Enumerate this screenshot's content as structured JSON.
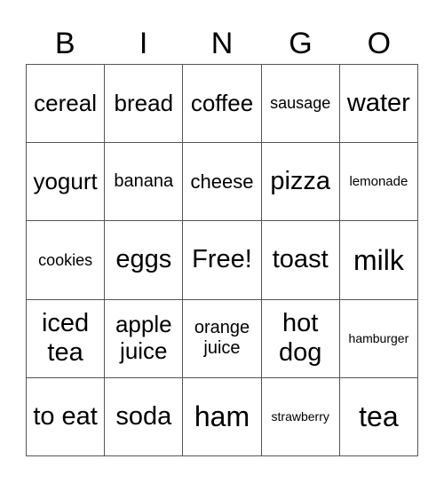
{
  "header": {
    "letters": [
      "B",
      "I",
      "N",
      "G",
      "O"
    ]
  },
  "grid": {
    "rows": [
      [
        "cereal",
        "bread",
        "coffee",
        "sausage",
        "water"
      ],
      [
        "yogurt",
        "banana",
        "cheese",
        "pizza",
        "lemonade"
      ],
      [
        "cookies",
        "eggs",
        "Free!",
        "toast",
        "milk"
      ],
      [
        "iced tea",
        "apple juice",
        "orange juice",
        "hot dog",
        "hamburger"
      ],
      [
        "to eat",
        "soda",
        "ham",
        "strawberry",
        "tea"
      ]
    ]
  }
}
